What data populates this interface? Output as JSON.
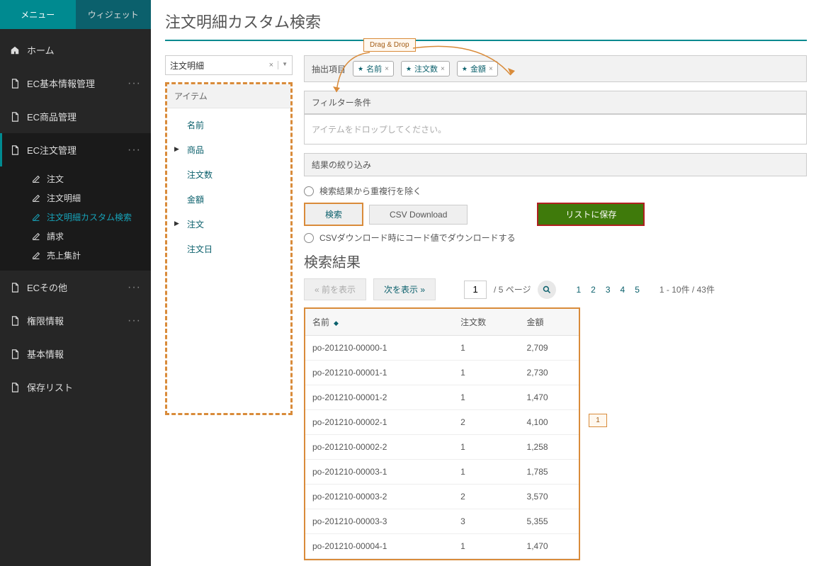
{
  "sidebar": {
    "tabs": {
      "menu": "メニュー",
      "widget": "ウィジェット"
    },
    "items": {
      "home": "ホーム",
      "ec_basic": "EC基本情報管理",
      "ec_product": "EC商品管理",
      "ec_order": "EC注文管理",
      "ec_other": "ECその他",
      "perm": "権限情報",
      "basic": "基本情報",
      "saved": "保存リスト"
    },
    "sub": {
      "order": "注文",
      "order_detail": "注文明細",
      "order_detail_custom": "注文明細カスタム検索",
      "invoice": "請求",
      "sales": "売上集計"
    }
  },
  "page": {
    "title": "注文明細カスタム検索",
    "entity_selected": "注文明細",
    "items_header": "アイテム",
    "tree": {
      "name": "名前",
      "product": "商品",
      "quantity": "注文数",
      "amount": "金額",
      "order": "注文",
      "order_date": "注文日"
    },
    "extract_label": "抽出項目",
    "chips": {
      "name": "名前",
      "quantity": "注文数",
      "amount": "金額"
    },
    "filter_label": "フィルター条件",
    "filter_placeholder": "アイテムをドロップしてください。",
    "narrow_label": "結果の絞り込み",
    "radio_dedup": "検索結果から重複行を除く",
    "btn_search": "検索",
    "btn_csv": "CSV Download",
    "btn_save": "リストに保存",
    "radio_csvcode": "CSVダウンロード時にコード値でダウンロードする",
    "result_title": "検索結果",
    "pager": {
      "prev": "« 前を表示",
      "next": "次を表示 »",
      "page": "1",
      "total_pages_label": "/ 5 ページ",
      "p1": "1",
      "p2": "2",
      "p3": "3",
      "p4": "4",
      "p5": "5",
      "range": "1 - 10件 / 43件"
    },
    "cols": {
      "name": "名前",
      "qty": "注文数",
      "amount": "金額"
    },
    "rows": [
      {
        "name": "po-201210-00000-1",
        "qty": "1",
        "amount": "2,709"
      },
      {
        "name": "po-201210-00001-1",
        "qty": "1",
        "amount": "2,730"
      },
      {
        "name": "po-201210-00001-2",
        "qty": "1",
        "amount": "1,470"
      },
      {
        "name": "po-201210-00002-1",
        "qty": "2",
        "amount": "4,100"
      },
      {
        "name": "po-201210-00002-2",
        "qty": "1",
        "amount": "1,258"
      },
      {
        "name": "po-201210-00003-1",
        "qty": "1",
        "amount": "1,785"
      },
      {
        "name": "po-201210-00003-2",
        "qty": "2",
        "amount": "3,570"
      },
      {
        "name": "po-201210-00003-3",
        "qty": "3",
        "amount": "5,355"
      },
      {
        "name": "po-201210-00004-1",
        "qty": "1",
        "amount": "1,470"
      }
    ],
    "callout_drag": "Drag & Drop",
    "callout_1": "1"
  }
}
